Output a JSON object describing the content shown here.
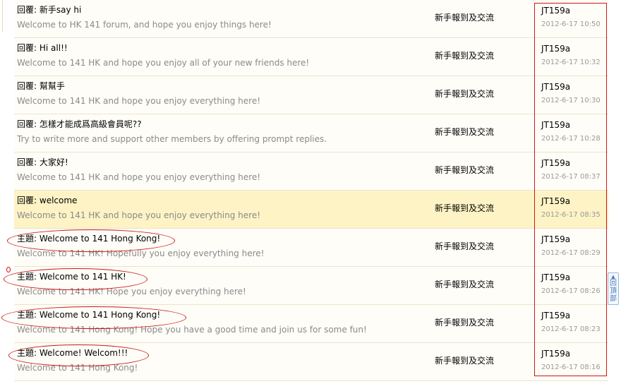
{
  "rows": [
    {
      "prefix": "回覆:",
      "subject": "新手say hi",
      "excerpt": "Welcome to HK 141 forum, and hope you enjoy things here!",
      "forum": "新手報到及交流",
      "author": "JT159a",
      "date": "2012-6-17 10:50"
    },
    {
      "prefix": "回覆:",
      "subject": "Hi all!!",
      "excerpt": "Welcome to 141 HK and hope you enjoy all of your new friends here!",
      "forum": "新手報到及交流",
      "author": "JT159a",
      "date": "2012-6-17 10:32"
    },
    {
      "prefix": "回覆:",
      "subject": "幫幫手",
      "excerpt": "Welcome to 141 HK and hope you enjoy everything here!",
      "forum": "新手報到及交流",
      "author": "JT159a",
      "date": "2012-6-17 10:30"
    },
    {
      "prefix": "回覆:",
      "subject": "怎樣才能成爲高級會員呢??",
      "excerpt": "Try to write more and support other members by offering prompt replies.",
      "forum": "新手報到及交流",
      "author": "JT159a",
      "date": "2012-6-17 10:28"
    },
    {
      "prefix": "回覆:",
      "subject": "大家好!",
      "excerpt": "Welcome to 141 HK and hope you enjoy everything here!",
      "forum": "新手報到及交流",
      "author": "JT159a",
      "date": "2012-6-17 08:37"
    },
    {
      "prefix": "回覆:",
      "subject": "welcome",
      "excerpt": "Welcome to 141 HK and hope you enjoy everything here!",
      "forum": "新手報到及交流",
      "author": "JT159a",
      "date": "2012-6-17 08:35"
    },
    {
      "prefix": "主題:",
      "subject": "Welcome to 141 Hong Kong!",
      "excerpt": "Welcome to 141 HK! Hopefully you enjoy everything here!",
      "forum": "新手報到及交流",
      "author": "JT159a",
      "date": "2012-6-17 08:29"
    },
    {
      "prefix": "主題:",
      "subject": "Welcome to 141 HK!",
      "excerpt": "Welcome to 141 HK! Hope you enjoy everything here!",
      "forum": "新手報到及交流",
      "author": "JT159a",
      "date": "2012-6-17 08:26"
    },
    {
      "prefix": "主題:",
      "subject": "Welcome to 141 Hong Kong!",
      "excerpt": "Welcome to 141 Hong Kong! Hope you have a good time and join us for some fun!",
      "forum": "新手報到及交流",
      "author": "JT159a",
      "date": "2012-6-17 08:23"
    },
    {
      "prefix": "主題:",
      "subject": "Welcome! Welcom!!!",
      "excerpt": "Welcome to 141 Hong Kong!",
      "forum": "新手報到及交流",
      "author": "JT159a",
      "date": "2012-6-17 08:16"
    }
  ],
  "back_to_top": {
    "label": "回頂部",
    "icon": "arrow-up-icon"
  },
  "colors": {
    "highlight_row": "#fdf3c5",
    "row_bg": "#fefdf8",
    "row_border": "#ece4c8",
    "annotation_red": "#cc1818",
    "excerpt_gray": "#8a8a8a",
    "date_gray": "#9a9a9a"
  }
}
